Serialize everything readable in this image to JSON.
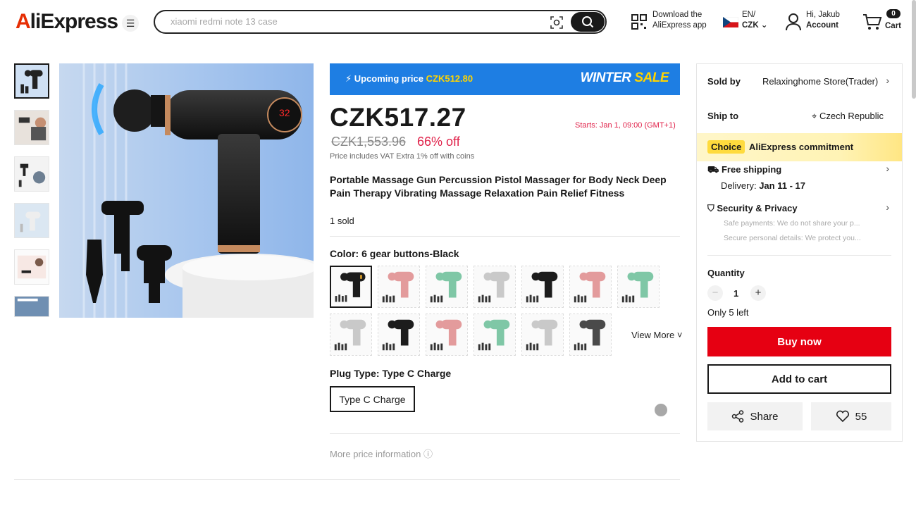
{
  "header": {
    "logo": "AliExpress",
    "search_placeholder": "xiaomi redmi note 13 case",
    "download_line1": "Download the",
    "download_line2": "AliExpress app",
    "lang": "EN/",
    "currency": "CZK",
    "greeting": "Hi, Jakub",
    "account": "Account",
    "cart_count": "0",
    "cart_label": "Cart"
  },
  "banner": {
    "upcoming_label": "Upcoming price",
    "upcoming_price": "CZK512.80",
    "sale_word1": "WINTER",
    "sale_word2": "SALE"
  },
  "product": {
    "price": "CZK517.27",
    "starts": "Starts:  Jan 1, 09:00 (GMT+1)",
    "old_price": "CZK1,553.96",
    "discount": "66% off",
    "vat_note": "Price includes VAT Extra 1% off with coins",
    "title": "Portable Massage Gun Percussion Pistol Massager for Body Neck Deep Pain Therapy Vibrating Massage Relaxation Pain Relief Fitness",
    "sold": "1 sold",
    "color_label": "Color: 6 gear buttons-Black",
    "view_more": "View More",
    "plug_label": "Plug Type: Type C Charge",
    "plug_option": "Type C Charge",
    "more_info": "More price information",
    "swatch_colors": [
      "#1c1c1c",
      "#e39b9c",
      "#7fc7a6",
      "#c9c9c9",
      "#1c1c1c",
      "#e39b9c",
      "#7fc7a6",
      "#c9c9c9",
      "#1c1c1c",
      "#e39b9c",
      "#7fc7a6",
      "#c9c9c9",
      "#4a4a4a"
    ]
  },
  "panel": {
    "sold_by_label": "Sold by",
    "store": "Relaxinghome Store(Trader)",
    "ship_to_label": "Ship to",
    "country": "Czech Republic",
    "choice_tag": "Choice",
    "commitment": "AliExpress commitment",
    "free_shipping": "Free shipping",
    "delivery_label": "Delivery:",
    "delivery_dates": "Jan 11 - 17",
    "security": "Security & Privacy",
    "safe_payments": "Safe payments: We do not share your p...",
    "secure_details": "Secure personal details: We protect you...",
    "quantity_label": "Quantity",
    "quantity_value": "1",
    "stock_note": "Only 5 left",
    "buy_now": "Buy now",
    "add_to_cart": "Add to cart",
    "share": "Share",
    "wishlist_count": "55"
  },
  "colors": {
    "brand_red": "#e60012",
    "price_red": "#e0224a",
    "banner_blue": "#1e7ee3",
    "choice_yellow": "#ffdb3d"
  }
}
